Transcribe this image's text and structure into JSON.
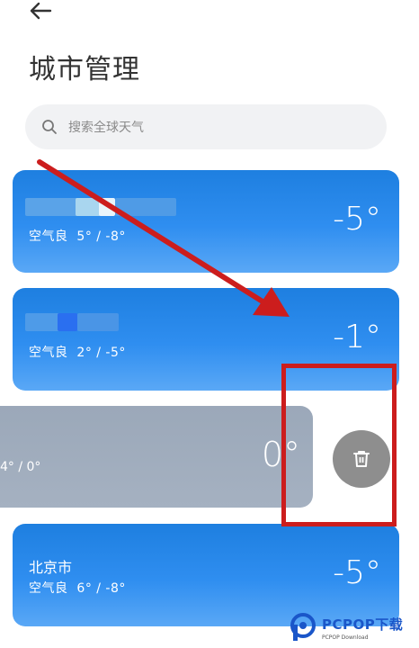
{
  "header": {
    "back_icon": "arrow-left-icon",
    "title": "城市管理"
  },
  "search": {
    "placeholder": "搜索全球天气",
    "icon": "search-icon"
  },
  "cities": [
    {
      "name": "",
      "air_quality": "空气良",
      "range": "5° / -8°",
      "temp": "-5°"
    },
    {
      "name": "",
      "air_quality": "空气良",
      "range": "2° / -5°",
      "temp": "-1°"
    },
    {
      "name": "",
      "air_quality": "",
      "range": "4° / 0°",
      "temp": "0°",
      "state": "swiped"
    },
    {
      "name": "北京市",
      "air_quality": "空气良",
      "range": "6° / -8°",
      "temp": "-5°"
    }
  ],
  "delete_action": {
    "icon": "trash-icon"
  },
  "colors": {
    "card_top": "#1e7fe0",
    "card_bottom": "#5aa8f6",
    "swiped_card": "#9ba8b9",
    "delete_button": "#8e8e8e",
    "annotation_red": "#cc1d1d"
  },
  "watermark": {
    "brand": "PCPOP下载",
    "sub": "PCPOP Download"
  }
}
